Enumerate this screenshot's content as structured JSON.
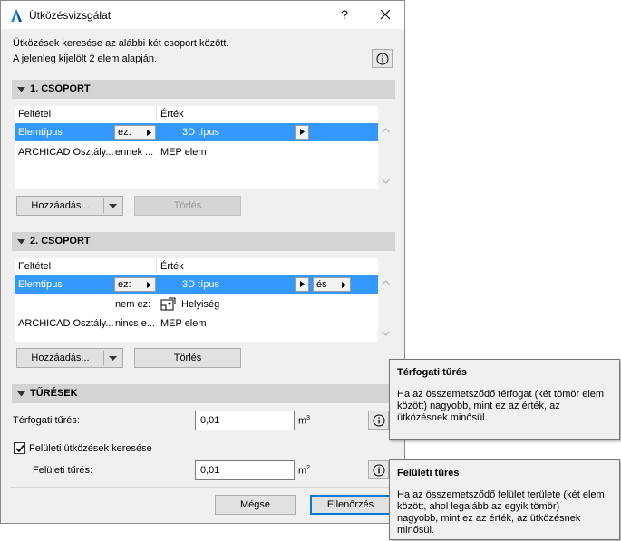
{
  "window": {
    "title": "Ütközésvizsgálat",
    "help_label": "?"
  },
  "intro": {
    "line1": "Ütközések keresése az alábbi két csoport között.",
    "line2": "A jelenleg kijelölt 2 elem alapján."
  },
  "group1": {
    "header": "1. CSOPORT",
    "col_condition": "Feltétel",
    "col_value": "Érték",
    "rows": [
      {
        "condition": "Elemtípus",
        "operator": "ez:",
        "value": "3D típus",
        "selected": true
      },
      {
        "condition": "ARCHICAD Osztály...",
        "operator": "ennek ...",
        "value": "MEP elem",
        "selected": false
      }
    ],
    "add_button": "Hozzáadás...",
    "delete_button": "Törlés",
    "delete_enabled": false
  },
  "group2": {
    "header": "2. CSOPORT",
    "col_condition": "Feltétel",
    "col_value": "Érték",
    "rows": [
      {
        "condition": "Elemtípus",
        "operator": "ez:",
        "value": "3D típus",
        "logic": "és",
        "selected": true
      },
      {
        "condition": "",
        "operator": "nem ez:",
        "value": "Helyiség",
        "icon": "zone-icon",
        "selected": false
      },
      {
        "condition": "ARCHICAD Osztály...",
        "operator": "nincs e...",
        "value": "MEP elem",
        "selected": false
      }
    ],
    "add_button": "Hozzáadás...",
    "delete_button": "Törlés",
    "delete_enabled": true
  },
  "tolerances": {
    "header": "TŰRÉSEK",
    "volume_label": "Térfogati tűrés:",
    "volume_value": "0,01",
    "volume_unit": "m",
    "volume_unit_sup": "3",
    "surface_checkbox_label": "Felületi ütközések keresése",
    "surface_checked": true,
    "surface_label": "Felületi tűrés:",
    "surface_value": "0,01",
    "surface_unit": "m",
    "surface_unit_sup": "2"
  },
  "footer": {
    "cancel_button": "Mégse",
    "check_button": "Ellenőrzés"
  },
  "tooltips": [
    {
      "title": "Térfogati tűrés",
      "lines": [
        "Ha az összemetsződő térfogat (két tömör elem",
        "között) nagyobb, mint ez az érték, az",
        "ütközésnek minősül."
      ]
    },
    {
      "title": "Felületi tűrés",
      "lines": [
        "Ha az összemetsződő felület területe (két elem",
        "között, ahol legalább az egyik tömör)",
        "nagyobb, mint ez az érték, az ütközésnek",
        "minősül."
      ]
    }
  ],
  "colors": {
    "selection": "#3399ff",
    "dialog_bg": "#f0f0f0",
    "section_header_bg": "#d4d4d4",
    "primary_border": "#0078d7"
  }
}
